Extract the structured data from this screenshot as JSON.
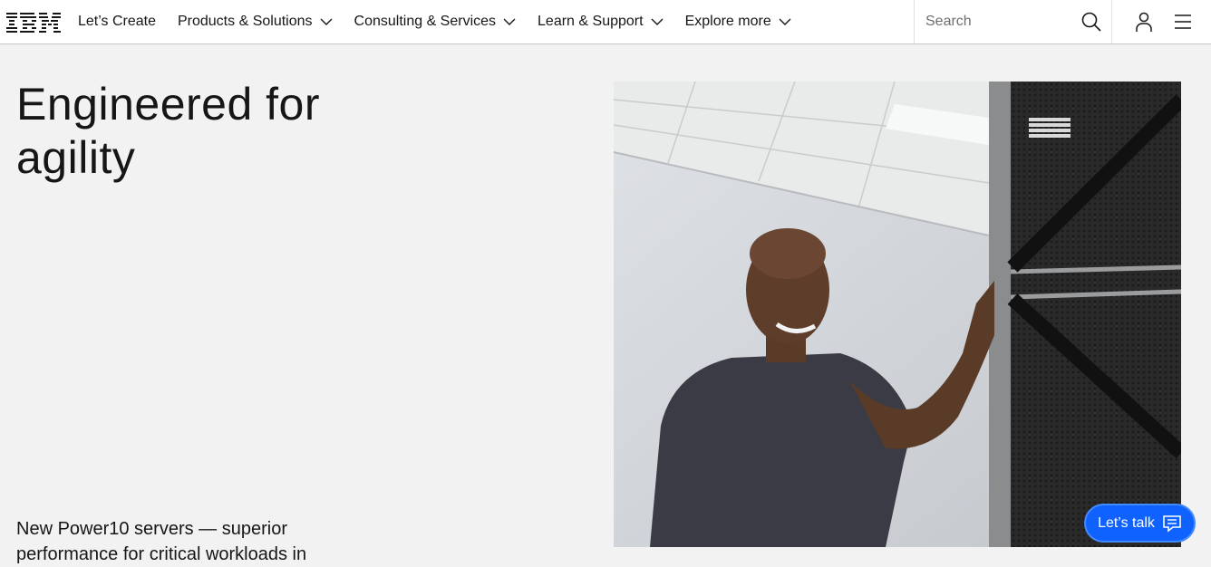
{
  "header": {
    "logo_text": "IBM",
    "nav": [
      {
        "label": "Let’s Create",
        "has_menu": false
      },
      {
        "label": "Products & Solutions",
        "has_menu": true
      },
      {
        "label": "Consulting & Services",
        "has_menu": true
      },
      {
        "label": "Learn & Support",
        "has_menu": true
      },
      {
        "label": "Explore more",
        "has_menu": true
      }
    ],
    "search": {
      "placeholder": "Search",
      "value": ""
    },
    "icons": [
      "search-icon",
      "user-icon",
      "menu-icon"
    ]
  },
  "hero": {
    "title": "Engineered for agility",
    "subtitle": "New Power10 servers — superior performance for critical workloads in",
    "image_label": "IBM"
  },
  "chat": {
    "label": "Let’s talk"
  },
  "colors": {
    "accent": "#0f62fe",
    "background": "#f2f2f2",
    "header": "#ffffff",
    "text": "#161616"
  }
}
